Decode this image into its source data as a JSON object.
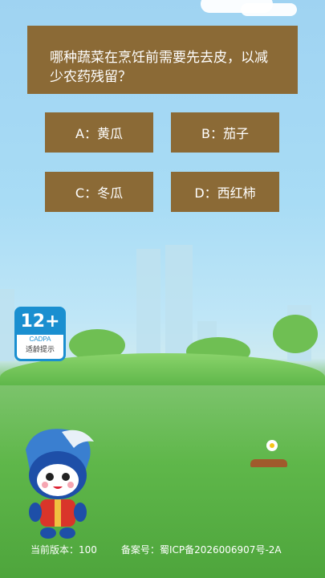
{
  "question": {
    "text": "哪种蔬菜在烹饪前需要先去皮，以减少农药残留？"
  },
  "options": [
    {
      "label": "A：黄瓜"
    },
    {
      "label": "B：茄子"
    },
    {
      "label": "C：冬瓜"
    },
    {
      "label": "D：西红柿"
    }
  ],
  "age_badge": {
    "age": "12+",
    "org": "CADPA",
    "caption": "适龄提示"
  },
  "footer": {
    "version_label": "当前版本：",
    "version_value": "100",
    "icp_label": "备案号：",
    "icp_value": "蜀ICP备2026006907号-2A"
  },
  "colors": {
    "card_bg": "#8b6a36",
    "badge_blue": "#1a8fd0"
  }
}
